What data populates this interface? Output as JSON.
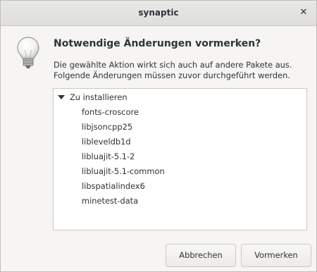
{
  "window": {
    "title": "synaptic",
    "close_glyph": "✕"
  },
  "dialog": {
    "icon": "lightbulb-icon",
    "heading": "Notwendige Änderungen vormerken?",
    "description_line1": "Die gewählte Aktion wirkt sich auch auf andere Pakete aus.",
    "description_line2": "Folgende Änderungen müssen zuvor durchgeführt werden."
  },
  "changes": {
    "group_label": "Zu installieren",
    "packages": [
      "fonts-croscore",
      "libjsoncpp25",
      "libleveldb1d",
      "libluajit-5.1-2",
      "libluajit-5.1-common",
      "libspatialindex6",
      "minetest-data"
    ]
  },
  "buttons": {
    "cancel_label": "Abbrechen",
    "ok_label": "Vormerken"
  }
}
